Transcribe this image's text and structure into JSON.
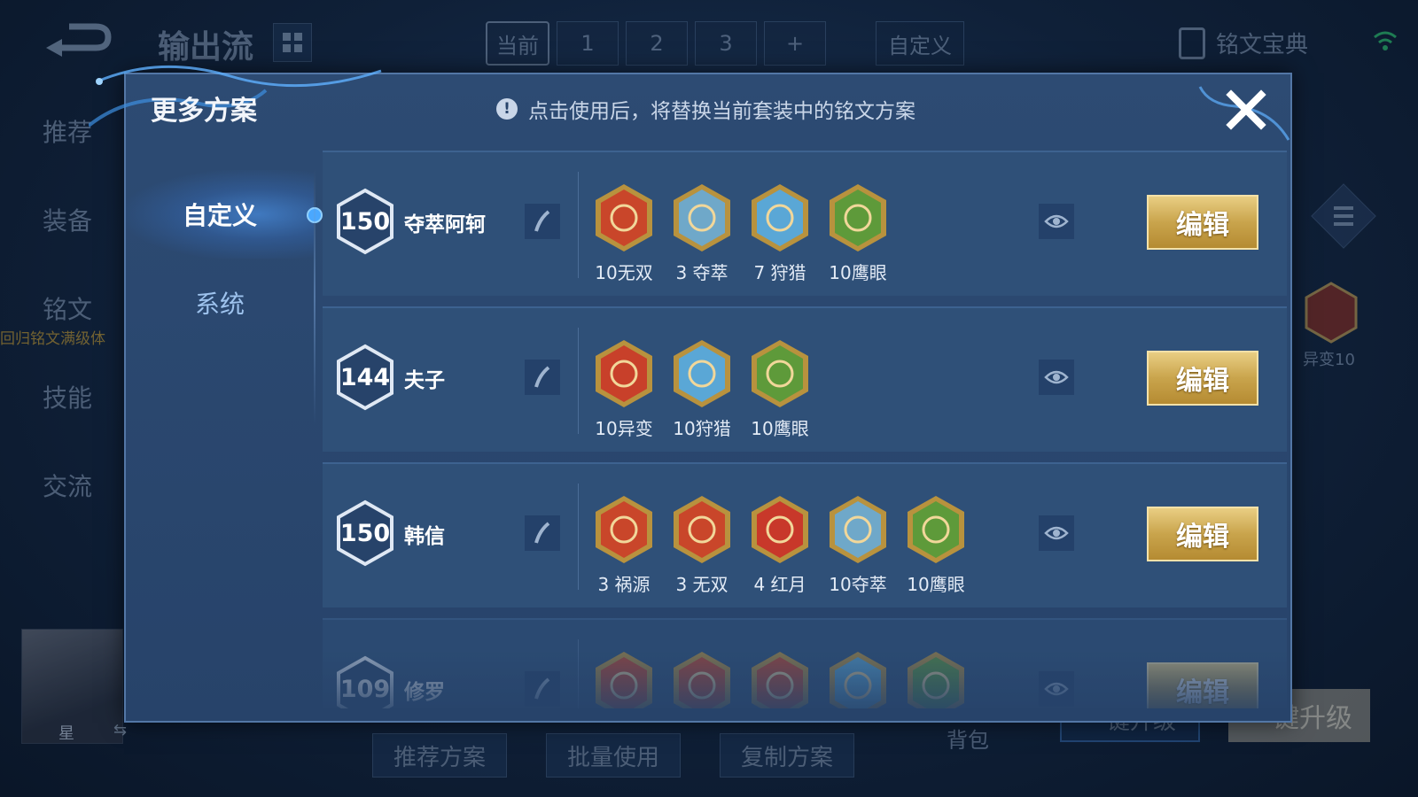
{
  "background": {
    "title": "输出流",
    "tabs": [
      "当前",
      "1",
      "2",
      "3",
      "+"
    ],
    "custom_tab": "自定义",
    "codex_label": "铭文宝典",
    "side_nav": [
      "推荐",
      "装备",
      "铭文",
      "技能",
      "交流"
    ],
    "promo_text": "回归铭文满级体",
    "hero_name": "星",
    "right_rune_label": "异变10",
    "bottom_buttons": [
      "推荐方案",
      "批量使用",
      "复制方案"
    ],
    "bag_label": "背包",
    "upgrade_label_1": "一键升级",
    "upgrade_label_2": "一键升级"
  },
  "modal": {
    "title": "更多方案",
    "notice": "点击使用后，将替换当前套装中的铭文方案",
    "nav": [
      {
        "label": "自定义",
        "active": true
      },
      {
        "label": "系统",
        "active": false
      }
    ],
    "edit_label": "编辑",
    "plans": [
      {
        "level": "150",
        "name": "夺萃阿轲",
        "runes": [
          {
            "label": "10无双",
            "icon": "rune-wushuang-icon",
            "color": "#c9462a"
          },
          {
            "label": "3 夺萃",
            "icon": "rune-duocui-icon",
            "color": "#6fa8c9"
          },
          {
            "label": "7 狩猎",
            "icon": "rune-shoulie-icon",
            "color": "#5aa7d6"
          },
          {
            "label": "10鹰眼",
            "icon": "rune-yingyan-icon",
            "color": "#5e9a3a"
          }
        ]
      },
      {
        "level": "144",
        "name": "夫子",
        "runes": [
          {
            "label": "10异变",
            "icon": "rune-yibian-icon",
            "color": "#c8402a"
          },
          {
            "label": "10狩猎",
            "icon": "rune-shoulie-icon",
            "color": "#5aa7d6"
          },
          {
            "label": "10鹰眼",
            "icon": "rune-yingyan-icon",
            "color": "#5e9a3a"
          }
        ]
      },
      {
        "level": "150",
        "name": "韩信",
        "runes": [
          {
            "label": "3 祸源",
            "icon": "rune-huoyuan-icon",
            "color": "#c9462a"
          },
          {
            "label": "3 无双",
            "icon": "rune-wushuang-icon",
            "color": "#c9462a"
          },
          {
            "label": "4 红月",
            "icon": "rune-hongyue-icon",
            "color": "#c8382a"
          },
          {
            "label": "10夺萃",
            "icon": "rune-duocui-icon",
            "color": "#6fa8c9"
          },
          {
            "label": "10鹰眼",
            "icon": "rune-yingyan-icon",
            "color": "#5e9a3a"
          }
        ]
      },
      {
        "level": "109",
        "name": "修罗",
        "runes": [
          {
            "label": "",
            "icon": "rune-red-icon",
            "color": "#c9462a"
          },
          {
            "label": "",
            "icon": "rune-red-icon",
            "color": "#c9462a"
          },
          {
            "label": "",
            "icon": "rune-red-icon",
            "color": "#c9462a"
          },
          {
            "label": "",
            "icon": "rune-blue-icon",
            "color": "#5aa7d6"
          },
          {
            "label": "",
            "icon": "rune-green-icon",
            "color": "#5e9a3a"
          }
        ]
      }
    ]
  },
  "colors": {
    "accent_gold": "#c9a44c",
    "panel": "#2d4b73",
    "row": "#2f5078"
  }
}
